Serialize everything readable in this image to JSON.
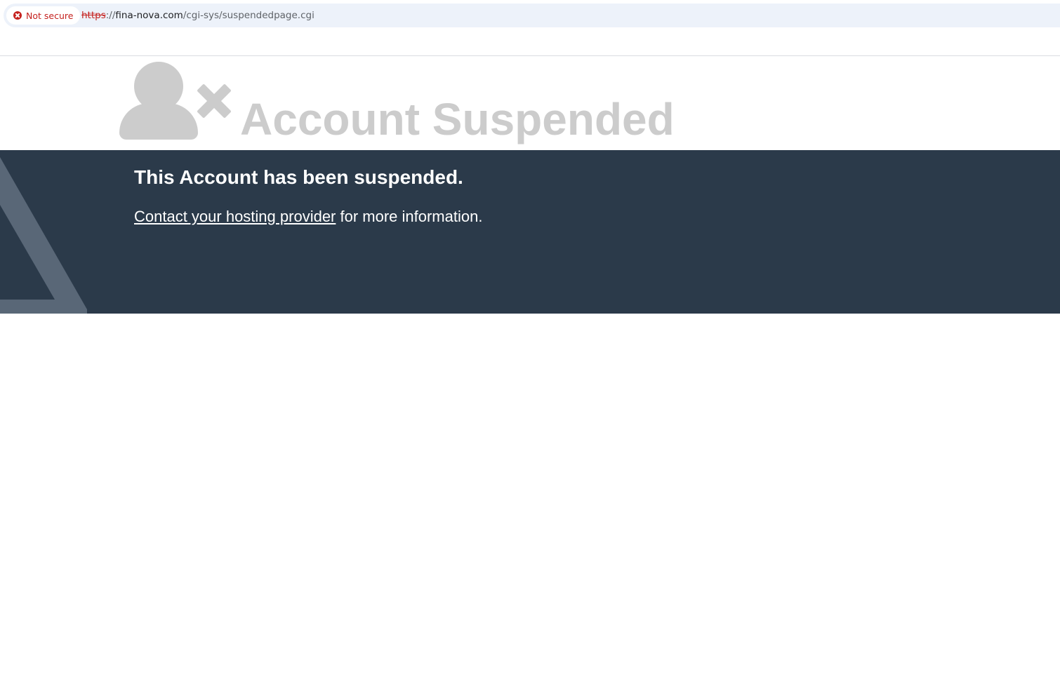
{
  "browser": {
    "security_label": "Not secure",
    "url_scheme": "https",
    "url_separator": "://",
    "url_host": "fina-nova.com",
    "url_path": "/cgi-sys/suspendedpage.cgi"
  },
  "page": {
    "title": "Account Suspended",
    "heading": "This Account has been suspended.",
    "contact_link": "Contact your hosting provider",
    "contact_suffix": " for more information."
  },
  "icons": {
    "security": "warning-cross-icon",
    "user": "user-icon",
    "suspended_mark": "cross-icon",
    "band_decoration": "triangle-decoration-icon"
  },
  "colors": {
    "band_background": "#2b3a4a",
    "title_gray": "#cccccc",
    "warning_red": "#c5221f",
    "address_bar": "#edf2fa"
  }
}
